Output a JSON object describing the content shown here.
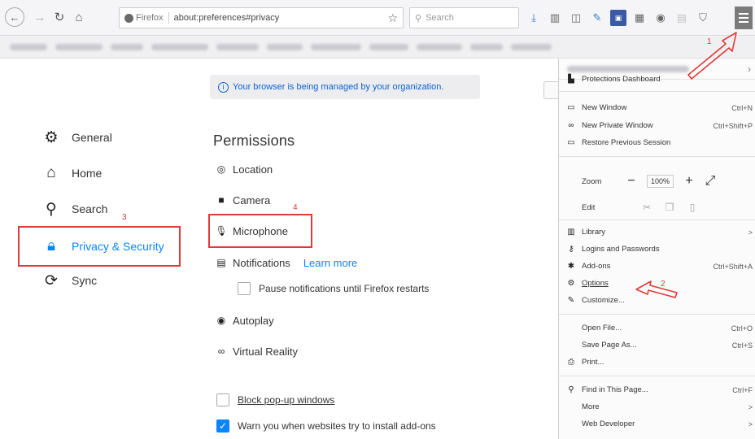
{
  "toolbar": {
    "url_prefix": "Firefox",
    "url": "about:preferences#privacy",
    "search_placeholder": "Search",
    "icons": [
      "download-icon",
      "library-icon",
      "sidebar-icon",
      "pen-icon",
      "extension-icon",
      "grid-icon",
      "circle-icon",
      "grey-ext-icon",
      "shield-icon"
    ]
  },
  "sidebar": {
    "items": [
      {
        "label": "General",
        "icon": "gear-icon"
      },
      {
        "label": "Home",
        "icon": "home-icon"
      },
      {
        "label": "Search",
        "icon": "search-icon"
      },
      {
        "label": "Privacy & Security",
        "icon": "lock-icon",
        "active": true
      },
      {
        "label": "Sync",
        "icon": "sync-icon"
      }
    ]
  },
  "main": {
    "notice": "Your browser is being managed by your organization.",
    "permissions_title": "Permissions",
    "permissions": [
      {
        "label": "Location",
        "icon": "location-icon"
      },
      {
        "label": "Camera",
        "icon": "camera-icon"
      },
      {
        "label": "Microphone",
        "icon": "microphone-icon"
      },
      {
        "label": "Notifications",
        "icon": "notifications-icon",
        "link": "Learn more"
      },
      {
        "label": "Autoplay",
        "icon": "autoplay-icon"
      },
      {
        "label": "Virtual Reality",
        "icon": "vr-icon"
      }
    ],
    "pause_notifications": "Pause notifications until Firefox restarts",
    "block_popups": "Block pop-up windows",
    "warn_addons": "Warn you when websites try to install add-ons"
  },
  "app_menu": {
    "protections_dashboard": "Protections Dashboard",
    "new_window": {
      "label": "New Window",
      "shortcut": "Ctrl+N"
    },
    "new_private_window": {
      "label": "New Private Window",
      "shortcut": "Ctrl+Shift+P"
    },
    "restore_session": "Restore Previous Session",
    "zoom": {
      "label": "Zoom",
      "value": "100%"
    },
    "edit": "Edit",
    "library": {
      "label": "Library",
      "shortcut": ">"
    },
    "logins": "Logins and Passwords",
    "addons": {
      "label": "Add-ons",
      "shortcut": "Ctrl+Shift+A"
    },
    "options": "Options",
    "customize": "Customize...",
    "open_file": {
      "label": "Open File...",
      "shortcut": "Ctrl+O"
    },
    "save_page": {
      "label": "Save Page As...",
      "shortcut": "Ctrl+S"
    },
    "print": "Print...",
    "find": {
      "label": "Find in This Page...",
      "shortcut": "Ctrl+F"
    },
    "more": {
      "label": "More",
      "shortcut": ">"
    },
    "web_developer": {
      "label": "Web Developer",
      "shortcut": ">"
    }
  },
  "annotations": {
    "one": "1",
    "two": "2",
    "three": "3",
    "four": "4"
  },
  "colors": {
    "accent": "#0a84ff",
    "annotation": "#e03a3a"
  }
}
